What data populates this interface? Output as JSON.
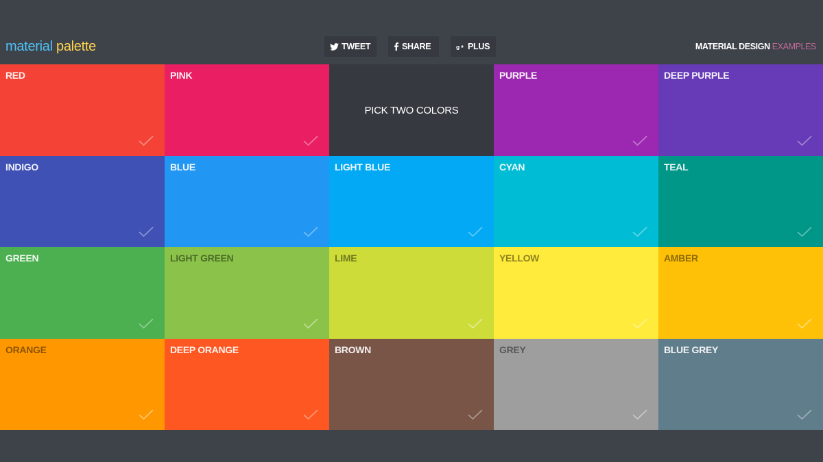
{
  "logo": {
    "part1": "material",
    "part2": "palette"
  },
  "share": [
    {
      "icon": "twitter-icon",
      "label": "TWEET"
    },
    {
      "icon": "facebook-icon",
      "label": "SHARE"
    },
    {
      "icon": "google-plus-icon",
      "label": "PLUS"
    }
  ],
  "nav": {
    "prefix": "MATERIAL DESIGN ",
    "accent": "EXAMPLES"
  },
  "center_prompt": "PICK TWO COLORS",
  "colors": [
    {
      "name": "RED",
      "hex": "#f44336",
      "text": "light"
    },
    {
      "name": "PINK",
      "hex": "#e91e63",
      "text": "light"
    },
    {
      "name": "PURPLE",
      "hex": "#9c27b0",
      "text": "light"
    },
    {
      "name": "DEEP PURPLE",
      "hex": "#673ab7",
      "text": "light"
    },
    {
      "name": "INDIGO",
      "hex": "#3f51b5",
      "text": "light"
    },
    {
      "name": "BLUE",
      "hex": "#2196f3",
      "text": "light"
    },
    {
      "name": "LIGHT BLUE",
      "hex": "#03a9f4",
      "text": "light"
    },
    {
      "name": "CYAN",
      "hex": "#00bcd4",
      "text": "light"
    },
    {
      "name": "TEAL",
      "hex": "#009688",
      "text": "light"
    },
    {
      "name": "GREEN",
      "hex": "#4caf50",
      "text": "light"
    },
    {
      "name": "LIGHT GREEN",
      "hex": "#8bc34a",
      "text": "dark"
    },
    {
      "name": "LIME",
      "hex": "#cddc39",
      "text": "dark"
    },
    {
      "name": "YELLOW",
      "hex": "#ffeb3b",
      "text": "dark"
    },
    {
      "name": "AMBER",
      "hex": "#ffc107",
      "text": "dark"
    },
    {
      "name": "ORANGE",
      "hex": "#ff9800",
      "text": "dark"
    },
    {
      "name": "DEEP ORANGE",
      "hex": "#ff5722",
      "text": "light"
    },
    {
      "name": "BROWN",
      "hex": "#795548",
      "text": "light"
    },
    {
      "name": "GREY",
      "hex": "#9e9e9e",
      "text": "dark"
    },
    {
      "name": "BLUE GREY",
      "hex": "#607d8b",
      "text": "light"
    }
  ]
}
